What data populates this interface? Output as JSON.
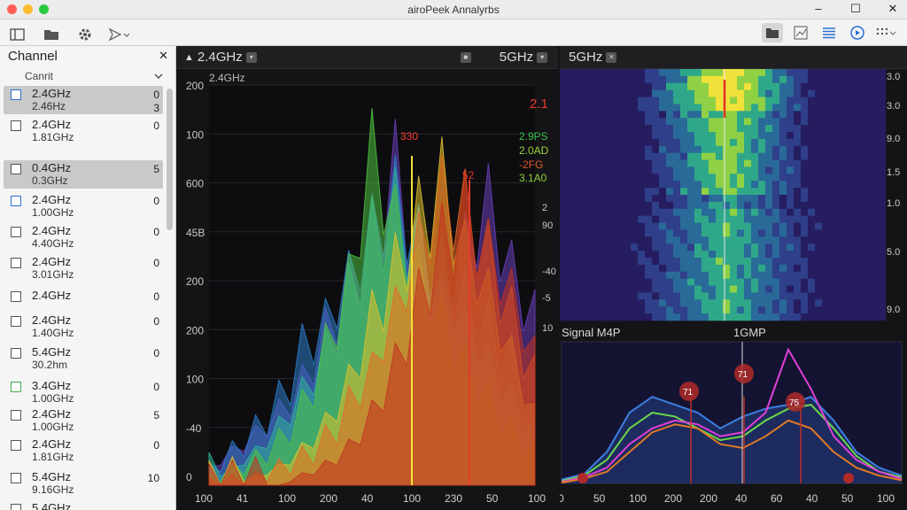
{
  "window": {
    "title": "airoPeek Annalyrbs",
    "lights": [
      "#ff5f57",
      "#febc2e",
      "#28c840"
    ],
    "controls": [
      "–",
      "☐",
      "✕"
    ]
  },
  "toolbar": {
    "left_icons": [
      "sidebar-icon",
      "folder-icon",
      "gear-icon",
      "send-icon"
    ],
    "right_icons": [
      "files-icon",
      "chart-icon",
      "list-icon",
      "play-icon",
      "grid-icon"
    ]
  },
  "sidebar": {
    "title": "Channel",
    "close": "✕",
    "filter_label": "Canrit",
    "channels": [
      {
        "line1": "2.4GHz",
        "line2": "2.46Hz",
        "count": "0",
        "count2": "3",
        "selected": true
      },
      {
        "line1": "2.4GHz",
        "line2": "1.81GHz",
        "count": "0",
        "selected": false
      },
      {
        "line1": "0.4GHz",
        "line2": "0.3GHz",
        "count": "5",
        "selected": true
      },
      {
        "line1": "2.4GHz",
        "line2": "1.00GHz",
        "count": "0",
        "selected": false
      },
      {
        "line1": "2.4GHz",
        "line2": "4.40GHz",
        "count": "0",
        "selected": false
      },
      {
        "line1": "2.4GHz",
        "line2": "3.01GHz",
        "count": "0",
        "selected": false
      },
      {
        "line1": "2.4GHz",
        "line2": "",
        "count": "0",
        "selected": false
      },
      {
        "line1": "2.4GHz",
        "line2": "1.40GHz",
        "count": "0",
        "selected": false
      },
      {
        "line1": "5.4GHz",
        "line2": "30.2hm",
        "count": "0",
        "selected": false
      },
      {
        "line1": "3.4GHz",
        "line2": "1.00GHz",
        "count": "0",
        "selected": false
      },
      {
        "line1": "2.4GHz",
        "line2": "1.00GHz",
        "count": "5",
        "selected": false
      },
      {
        "line1": "2.4GHz",
        "line2": "1.81GHz",
        "count": "0",
        "selected": false
      },
      {
        "line1": "5.4GHz",
        "line2": "9.16GHz",
        "count": "10",
        "selected": false
      },
      {
        "line1": "5.4GHz",
        "line2": "",
        "count": "",
        "selected": false
      }
    ]
  },
  "panels": {
    "left_tab": "2.4GHz",
    "mid_tab": "5GHz",
    "right_tab": "5GHz"
  },
  "chart_data": [
    {
      "type": "area",
      "title": "2.4GHz",
      "y_ticks": [
        "200",
        "100",
        "600",
        "45B",
        "200",
        "200",
        "100",
        "-40",
        "0"
      ],
      "x_ticks": [
        "100",
        "41",
        "100",
        "200",
        "40",
        "100",
        "230",
        "50",
        "100"
      ],
      "right_ticks": [
        "2",
        "90",
        "-40",
        "-5",
        "10"
      ],
      "legend": [
        {
          "label": "2.1",
          "color": "#e63a2e"
        },
        {
          "label": "2.9PS",
          "color": "#37c24a"
        },
        {
          "label": "2.0AD",
          "color": "#9fd23a"
        },
        {
          "label": "-2FG",
          "color": "#e0542c"
        },
        {
          "label": "3.1A0",
          "color": "#8bd03a"
        }
      ],
      "annotations": [
        {
          "label": "330",
          "color": "#ff3b30"
        },
        {
          "label": "52",
          "color": "#e23b2b"
        }
      ],
      "series": [
        {
          "color": "#6a3fb8",
          "values": [
            20,
            40,
            60,
            85,
            120,
            180,
            240,
            300,
            380,
            270,
            230,
            300,
            350,
            260,
            200
          ]
        },
        {
          "color": "#2d7ec9",
          "values": [
            10,
            30,
            55,
            90,
            150,
            210,
            260,
            320,
            360,
            300,
            260,
            220,
            180,
            140,
            90
          ]
        },
        {
          "color": "#2fb39a",
          "values": [
            5,
            20,
            40,
            70,
            110,
            160,
            230,
            300,
            330,
            280,
            240,
            200,
            150,
            100,
            60
          ]
        },
        {
          "color": "#4fc23f",
          "values": [
            0,
            10,
            20,
            40,
            80,
            150,
            260,
            420,
            330,
            260,
            200,
            140,
            90,
            50,
            20
          ]
        },
        {
          "color": "#e0c12a",
          "values": [
            0,
            0,
            10,
            20,
            40,
            70,
            120,
            200,
            260,
            320,
            360,
            300,
            240,
            160,
            80
          ]
        },
        {
          "color": "#e56a24",
          "values": [
            0,
            0,
            0,
            10,
            20,
            40,
            80,
            150,
            220,
            300,
            360,
            340,
            280,
            200,
            120
          ]
        },
        {
          "color": "#c3311f",
          "values": [
            0,
            0,
            0,
            0,
            10,
            20,
            40,
            80,
            140,
            220,
            290,
            320,
            300,
            240,
            160
          ]
        }
      ]
    },
    {
      "type": "heatmap",
      "title": "5GHz",
      "right_ticks": [
        "3.0",
        "3.0",
        "9.0",
        "1.5",
        "1.0",
        "5.0",
        "9.0"
      ]
    },
    {
      "type": "line",
      "title": "Signal M4P",
      "subtitle": "1GMP",
      "x_ticks": [
        "0",
        "50",
        "100",
        "200",
        "200",
        "40",
        "60",
        "40",
        "50",
        "100"
      ],
      "markers": [
        "71",
        "71",
        "75"
      ],
      "series": [
        {
          "color": "#3b7fe0",
          "values": [
            5,
            12,
            40,
            90,
            110,
            100,
            90,
            70,
            85,
            95,
            100,
            110,
            80,
            40,
            20,
            10
          ]
        },
        {
          "color": "#6bd84a",
          "values": [
            3,
            10,
            30,
            70,
            90,
            85,
            70,
            55,
            60,
            80,
            95,
            100,
            70,
            35,
            15,
            8
          ]
        },
        {
          "color": "#e040d8",
          "values": [
            2,
            8,
            20,
            50,
            70,
            80,
            75,
            60,
            65,
            90,
            170,
            120,
            60,
            30,
            15,
            6
          ]
        },
        {
          "color": "#e07a26",
          "values": [
            1,
            6,
            15,
            40,
            65,
            75,
            70,
            50,
            45,
            60,
            80,
            70,
            40,
            20,
            10,
            4
          ]
        }
      ]
    }
  ]
}
